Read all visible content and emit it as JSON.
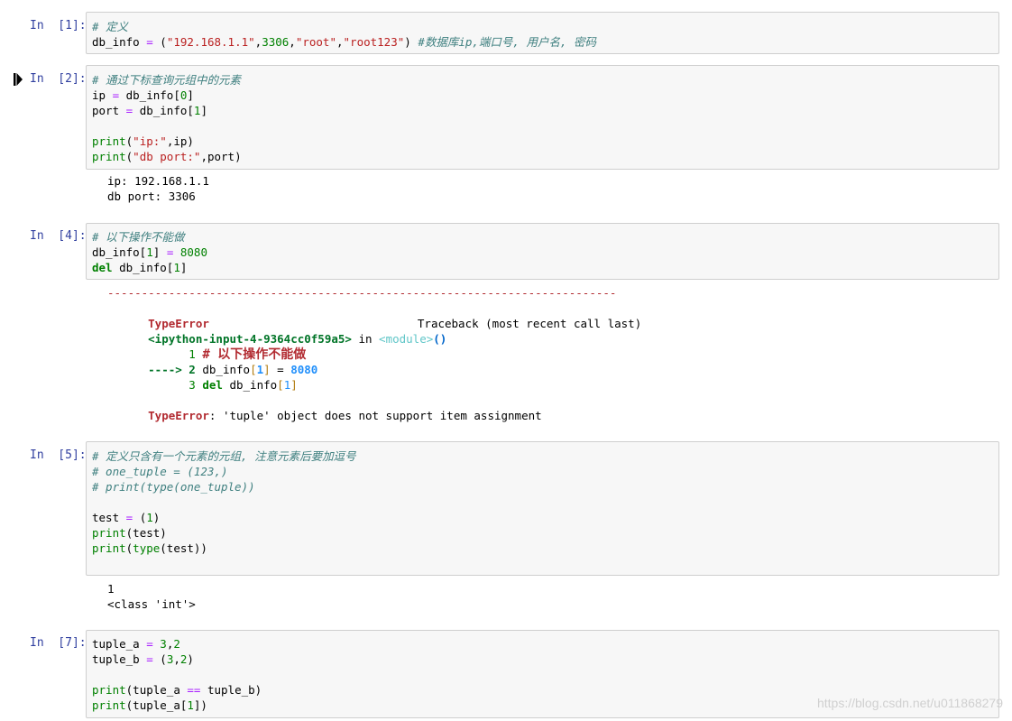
{
  "cells": [
    {
      "prompt": "In  [1]:",
      "lines": [
        [
          {
            "t": "# 定义",
            "c": "cm"
          }
        ],
        [
          {
            "t": "db_info ",
            "c": ""
          },
          {
            "t": "=",
            "c": "op"
          },
          {
            "t": " (",
            "c": ""
          },
          {
            "t": "\"192.168.1.1\"",
            "c": "str"
          },
          {
            "t": ",",
            "c": ""
          },
          {
            "t": "3306",
            "c": "num"
          },
          {
            "t": ",",
            "c": ""
          },
          {
            "t": "\"root\"",
            "c": "str"
          },
          {
            "t": ",",
            "c": ""
          },
          {
            "t": "\"root123\"",
            "c": "str"
          },
          {
            "t": ") ",
            "c": ""
          },
          {
            "t": "#数据库ip,端口号, 用户名, 密码",
            "c": "cm"
          }
        ]
      ]
    },
    {
      "prompt": "In  [2]:",
      "lines": [
        [
          {
            "t": "# 通过下标查询元组中的元素",
            "c": "cm"
          }
        ],
        [
          {
            "t": "ip ",
            "c": ""
          },
          {
            "t": "=",
            "c": "op"
          },
          {
            "t": " db_info[",
            "c": ""
          },
          {
            "t": "0",
            "c": "num"
          },
          {
            "t": "]",
            "c": ""
          }
        ],
        [
          {
            "t": "port ",
            "c": ""
          },
          {
            "t": "=",
            "c": "op"
          },
          {
            "t": " db_info[",
            "c": ""
          },
          {
            "t": "1",
            "c": "num"
          },
          {
            "t": "]",
            "c": ""
          }
        ],
        [],
        [
          {
            "t": "print",
            "c": "bi"
          },
          {
            "t": "(",
            "c": ""
          },
          {
            "t": "\"ip:\"",
            "c": "str"
          },
          {
            "t": ",ip)",
            "c": ""
          }
        ],
        [
          {
            "t": "print",
            "c": "bi"
          },
          {
            "t": "(",
            "c": ""
          },
          {
            "t": "\"db port:\"",
            "c": "str"
          },
          {
            "t": ",port)",
            "c": ""
          }
        ]
      ],
      "output": [
        "ip: 192.168.1.1",
        "db port: 3306"
      ]
    },
    {
      "prompt": "In  [4]:",
      "lines": [
        [
          {
            "t": "# 以下操作不能做",
            "c": "cm"
          }
        ],
        [
          {
            "t": "db_info[",
            "c": ""
          },
          {
            "t": "1",
            "c": "num"
          },
          {
            "t": "] ",
            "c": ""
          },
          {
            "t": "=",
            "c": "op"
          },
          {
            "t": " ",
            "c": ""
          },
          {
            "t": "8080",
            "c": "num"
          }
        ],
        [
          {
            "t": "del",
            "c": "kw"
          },
          {
            "t": " db_info[",
            "c": ""
          },
          {
            "t": "1",
            "c": "num"
          },
          {
            "t": "]",
            "c": ""
          }
        ]
      ],
      "traceback": {
        "dashes": "---------------------------------------------------------------------------",
        "error_name": "TypeError",
        "traceback_label": "Traceback (most recent call last)",
        "input_ref": "<ipython-input-4-9364cc0f59a5>",
        "in_word": " in ",
        "module": "<module>",
        "parens": "()",
        "line1_no": "      1 ",
        "line1_code": "# 以下操作不能做",
        "arrow": "----> 2 ",
        "line2_a": "db_info",
        "line2_b": "[",
        "line2_c": "1",
        "line2_d": "]",
        "line2_e": " = ",
        "line2_f": "8080",
        "line3_no": "      3 ",
        "line3_kw": "del",
        "line3_a": " db_info",
        "line3_b": "[",
        "line3_c": "1",
        "line3_d": "]",
        "final_name": "TypeError",
        "final_msg": ": 'tuple' object does not support item assignment"
      }
    },
    {
      "prompt": "In  [5]:",
      "lines": [
        [
          {
            "t": "# 定义只含有一个元素的元组, 注意元素后要加逗号",
            "c": "cm"
          }
        ],
        [
          {
            "t": "# one_tuple = (123,)",
            "c": "cm"
          }
        ],
        [
          {
            "t": "# print(type(one_tuple))",
            "c": "cm"
          }
        ],
        [],
        [
          {
            "t": "test ",
            "c": ""
          },
          {
            "t": "=",
            "c": "op"
          },
          {
            "t": " (",
            "c": ""
          },
          {
            "t": "1",
            "c": "num"
          },
          {
            "t": ")",
            "c": ""
          }
        ],
        [
          {
            "t": "print",
            "c": "bi"
          },
          {
            "t": "(test)",
            "c": ""
          }
        ],
        [
          {
            "t": "print",
            "c": "bi"
          },
          {
            "t": "(",
            "c": ""
          },
          {
            "t": "type",
            "c": "bi"
          },
          {
            "t": "(test))",
            "c": ""
          }
        ]
      ],
      "output": [
        "1",
        "<class 'int'>"
      ]
    },
    {
      "prompt": "In  [7]:",
      "lines": [
        [
          {
            "t": "tuple_a ",
            "c": ""
          },
          {
            "t": "=",
            "c": "op"
          },
          {
            "t": " ",
            "c": ""
          },
          {
            "t": "3",
            "c": "num"
          },
          {
            "t": ",",
            "c": ""
          },
          {
            "t": "2",
            "c": "num"
          }
        ],
        [
          {
            "t": "tuple_b ",
            "c": ""
          },
          {
            "t": "=",
            "c": "op"
          },
          {
            "t": " (",
            "c": ""
          },
          {
            "t": "3",
            "c": "num"
          },
          {
            "t": ",",
            "c": ""
          },
          {
            "t": "2",
            "c": "num"
          },
          {
            "t": ")",
            "c": ""
          }
        ],
        [],
        [
          {
            "t": "print",
            "c": "bi"
          },
          {
            "t": "(tuple_a ",
            "c": ""
          },
          {
            "t": "==",
            "c": "op"
          },
          {
            "t": " tuple_b)",
            "c": ""
          }
        ],
        [
          {
            "t": "print",
            "c": "bi"
          },
          {
            "t": "(tuple_a[",
            "c": ""
          },
          {
            "t": "1",
            "c": "num"
          },
          {
            "t": "])",
            "c": ""
          }
        ]
      ]
    }
  ],
  "watermark": "https://blog.csdn.net/u011868279",
  "icons": {
    "run_marker": "step-cursor-icon"
  }
}
